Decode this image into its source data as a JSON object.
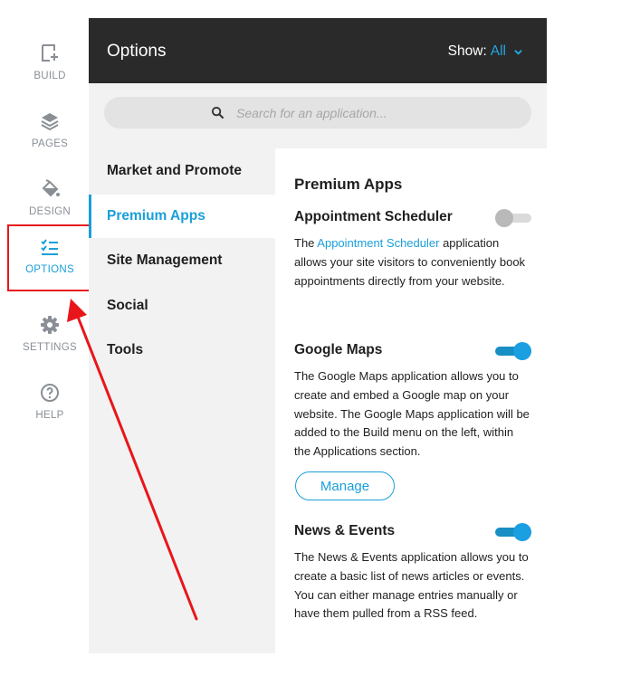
{
  "sidebar": {
    "items": [
      {
        "label": "BUILD",
        "icon": "build-add-icon"
      },
      {
        "label": "PAGES",
        "icon": "layers-icon"
      },
      {
        "label": "DESIGN",
        "icon": "paint-bucket-icon"
      },
      {
        "label": "OPTIONS",
        "icon": "checklist-icon",
        "active": true
      },
      {
        "label": "SETTINGS",
        "icon": "gear-icon"
      },
      {
        "label": "HELP",
        "icon": "help-circle-icon"
      }
    ]
  },
  "header": {
    "title": "Options",
    "show_label": "Show:",
    "show_value": "All"
  },
  "search": {
    "placeholder": "Search for an application...",
    "value": ""
  },
  "categories": [
    {
      "label": "Market and Promote"
    },
    {
      "label": "Premium Apps",
      "active": true
    },
    {
      "label": "Site Management"
    },
    {
      "label": "Social"
    },
    {
      "label": "Tools"
    }
  ],
  "content": {
    "section_title": "Premium Apps",
    "apps": [
      {
        "name": "Appointment Scheduler",
        "enabled": false,
        "desc_prefix": "The ",
        "desc_link": "Appointment Scheduler",
        "desc_suffix": " application allows your site visitors to conveniently book appointments directly from your website."
      },
      {
        "name": "Google Maps",
        "enabled": true,
        "description": "The Google Maps application allows you to create and embed a Google map on your website. The Google Maps application will be added to the Build menu on the left, within the Applications section.",
        "action_label": "Manage"
      },
      {
        "name": "News & Events",
        "enabled": true,
        "description": "The News & Events application allows you to create a basic list of news articles or events. You can either manage entries manually or have them pulled from a RSS feed."
      }
    ]
  },
  "colors": {
    "accent": "#1a9fd9",
    "header_bg": "#2a2a2a",
    "highlight_box": "#e8161b",
    "annotation_arrow": "#e8161b"
  }
}
